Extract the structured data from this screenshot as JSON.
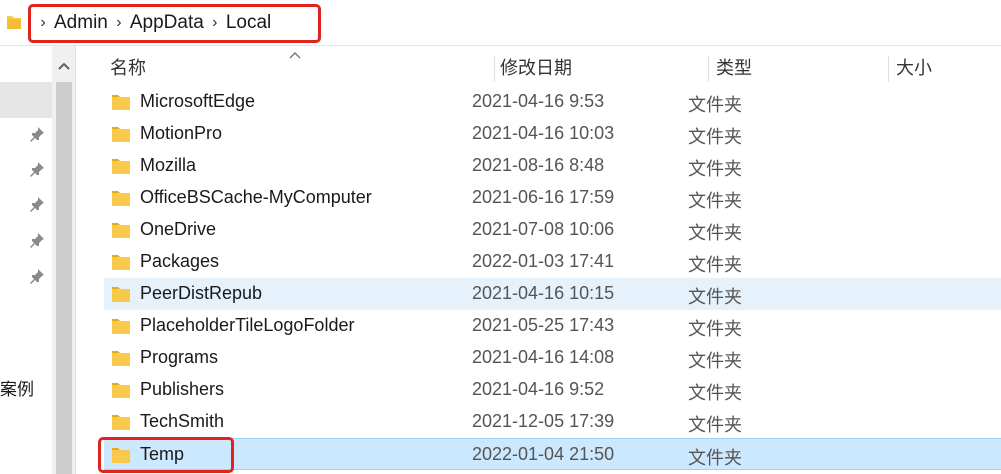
{
  "address_bar": {
    "crumbs": [
      "Admin",
      "AppData",
      "Local"
    ],
    "separator": "›"
  },
  "nav_pane": {
    "partial_label": "案例"
  },
  "columns": {
    "name": "名称",
    "date": "修改日期",
    "type": "类型",
    "size": "大小"
  },
  "files": [
    {
      "name": "MicrosoftEdge",
      "date": "2021-04-16 9:53",
      "type": "文件夹"
    },
    {
      "name": "MotionPro",
      "date": "2021-04-16 10:03",
      "type": "文件夹"
    },
    {
      "name": "Mozilla",
      "date": "2021-08-16 8:48",
      "type": "文件夹"
    },
    {
      "name": "OfficeBSCache-MyComputer",
      "date": "2021-06-16 17:59",
      "type": "文件夹"
    },
    {
      "name": "OneDrive",
      "date": "2021-07-08 10:06",
      "type": "文件夹"
    },
    {
      "name": "Packages",
      "date": "2022-01-03 17:41",
      "type": "文件夹"
    },
    {
      "name": "PeerDistRepub",
      "date": "2021-04-16 10:15",
      "type": "文件夹"
    },
    {
      "name": "PlaceholderTileLogoFolder",
      "date": "2021-05-25 17:43",
      "type": "文件夹"
    },
    {
      "name": "Programs",
      "date": "2021-04-16 14:08",
      "type": "文件夹"
    },
    {
      "name": "Publishers",
      "date": "2021-04-16 9:52",
      "type": "文件夹"
    },
    {
      "name": "TechSmith",
      "date": "2021-12-05 17:39",
      "type": "文件夹"
    },
    {
      "name": "Temp",
      "date": "2022-01-04 21:50",
      "type": "文件夹"
    }
  ],
  "colors": {
    "folder": "#f8c94a",
    "folder_dark": "#e8a917",
    "highlight_red": "#e0231e",
    "hover_row": "#e5f1fb",
    "selected_row": "#cce8ff"
  }
}
